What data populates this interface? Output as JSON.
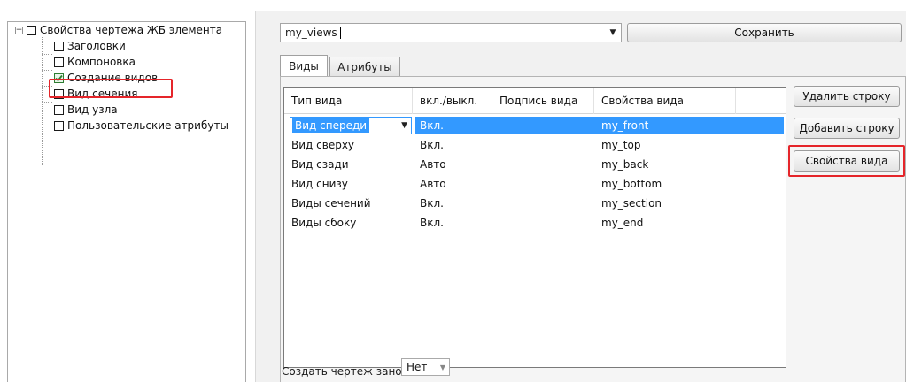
{
  "tree": {
    "root_label": "Свойства чертежа ЖБ элемента",
    "items": [
      {
        "label": "Заголовки",
        "checked": false
      },
      {
        "label": "Компоновка",
        "checked": false
      },
      {
        "label": "Создание видов",
        "checked": true
      },
      {
        "label": "Вид сечения",
        "checked": false
      },
      {
        "label": "Вид узла",
        "checked": false
      },
      {
        "label": "Пользовательские атрибуты",
        "checked": false
      }
    ]
  },
  "settings_combo": {
    "value": "my_views"
  },
  "toolbar": {
    "save_label": "Сохранить"
  },
  "tabs": [
    {
      "label": "Виды",
      "active": true
    },
    {
      "label": "Атрибуты",
      "active": false
    }
  ],
  "grid": {
    "columns": [
      "Тип вида",
      "вкл./выкл.",
      "Подпись вида",
      "Свойства вида"
    ],
    "rows": [
      {
        "type": "Вид спереди",
        "state": "Вкл.",
        "caption": "",
        "props": "my_front"
      },
      {
        "type": "Вид сверху",
        "state": "Вкл.",
        "caption": "",
        "props": "my_top"
      },
      {
        "type": "Вид сзади",
        "state": "Авто",
        "caption": "",
        "props": "my_back"
      },
      {
        "type": "Вид снизу",
        "state": "Авто",
        "caption": "",
        "props": "my_bottom"
      },
      {
        "type": "Виды сечений",
        "state": "Вкл.",
        "caption": "",
        "props": "my_section"
      },
      {
        "type": "Виды сбоку",
        "state": "Вкл.",
        "caption": "",
        "props": "my_end"
      }
    ],
    "selected_row": 0
  },
  "side_buttons": {
    "delete_row": "Удалить строку",
    "add_row": "Добавить строку",
    "view_properties": "Свойства вида"
  },
  "recreate": {
    "label": "Создать чертеж заново",
    "value": "Нет"
  },
  "colors": {
    "highlight": "#e5252a",
    "selection": "#3399ff",
    "check": "#2e7d32"
  }
}
